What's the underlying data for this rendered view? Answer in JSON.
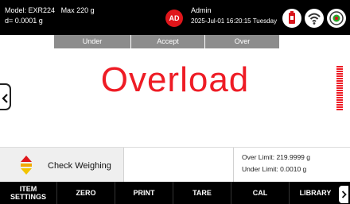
{
  "header": {
    "model": "Model: EXR224",
    "max": "Max 220 g",
    "resolution": "d= 0.0001 g",
    "avatar_initials": "AD",
    "user": "Admin",
    "datetime": "2025-Jul-01 16:20:15 Tuesday",
    "status_icons": [
      "usb-drive-icon",
      "wifi-icon",
      "level-bubble-icon"
    ]
  },
  "limit_bands": {
    "under": "Under",
    "accept": "Accept",
    "over": "Over"
  },
  "display": {
    "value": "Overload",
    "value_color": "#ee1c25"
  },
  "info": {
    "mode_label": "Check Weighing",
    "over_limit": "Over Limit: 219.9999 g",
    "under_limit": "Under Limit: 0.0010 g"
  },
  "function_keys": {
    "item_settings_line1": "ITEM",
    "item_settings_line2": "SETTINGS",
    "zero": "ZERO",
    "print": "PRINT",
    "tare": "TARE",
    "cal": "CAL",
    "library": "LIBRARY"
  },
  "colors": {
    "accent_red": "#ee1c25",
    "band_gray": "#8c8c8c",
    "bar_black": "#000000"
  }
}
